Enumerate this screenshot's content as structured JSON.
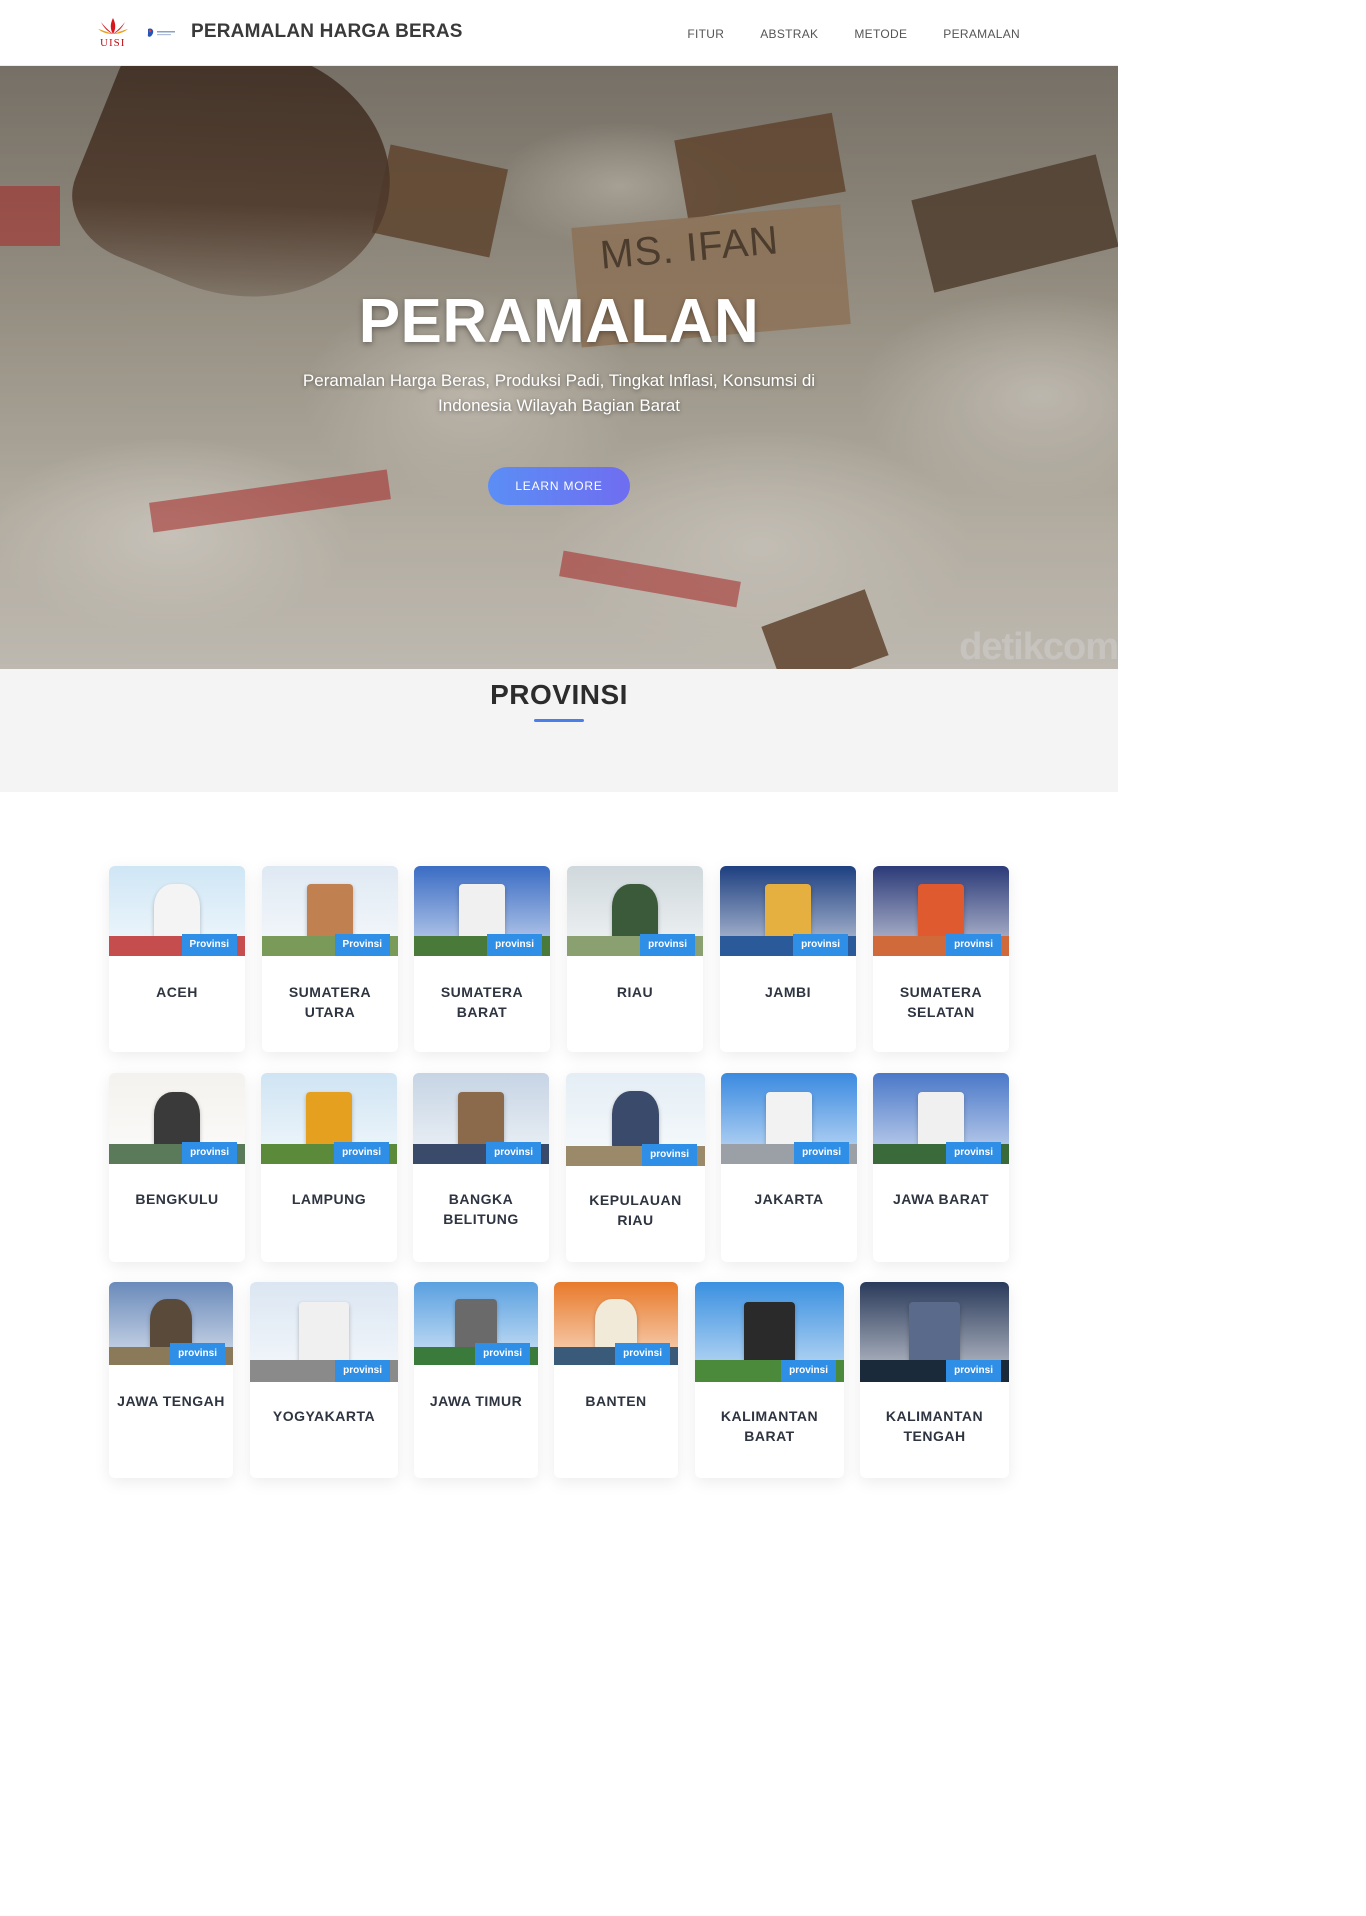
{
  "navbar": {
    "logo_text": "UISI",
    "brand": "PERAMALAN HARGA BERAS",
    "menu": [
      "FITUR",
      "ABSTRAK",
      "METODE",
      "PERAMALAN"
    ]
  },
  "hero": {
    "title": "PERAMALAN",
    "subtitle": "Peramalan Harga Beras, Produksi Padi, Tingkat Inflasi, Konsumsi di Indonesia Wilayah Bagian Barat",
    "button": "LEARN MORE",
    "sign_text": "MS. IFAN",
    "watermark": "detikcom"
  },
  "section": {
    "title": "PROVINSI"
  },
  "provinces": [
    {
      "name": "ACEH",
      "badge": "Provinsi"
    },
    {
      "name": "SUMATERA UTARA",
      "badge": "Provinsi"
    },
    {
      "name": "SUMATERA BARAT",
      "badge": "provinsi"
    },
    {
      "name": "RIAU",
      "badge": "provinsi"
    },
    {
      "name": "JAMBI",
      "badge": "provinsi"
    },
    {
      "name": "SUMATERA SELATAN",
      "badge": "provinsi"
    },
    {
      "name": "BENGKULU",
      "badge": "provinsi"
    },
    {
      "name": "LAMPUNG",
      "badge": "provinsi"
    },
    {
      "name": "BANGKA BELITUNG",
      "badge": "provinsi"
    },
    {
      "name": "KEPULAUAN RIAU",
      "badge": "provinsi"
    },
    {
      "name": "JAKARTA",
      "badge": "provinsi"
    },
    {
      "name": "JAWA BARAT",
      "badge": "provinsi"
    },
    {
      "name": "JAWA TENGAH",
      "badge": "provinsi"
    },
    {
      "name": "YOGYAKARTA",
      "badge": "provinsi"
    },
    {
      "name": "JAWA TIMUR",
      "badge": "provinsi"
    },
    {
      "name": "BANTEN",
      "badge": "provinsi"
    },
    {
      "name": "KALIMANTAN BARAT",
      "badge": "provinsi"
    },
    {
      "name": "KALIMANTAN TENGAH",
      "badge": "provinsi"
    }
  ],
  "colors": {
    "accent": "#2f8fe6",
    "button_start": "#5b8ef5",
    "button_end": "#6f6df0",
    "underline": "#4a7ee8"
  }
}
